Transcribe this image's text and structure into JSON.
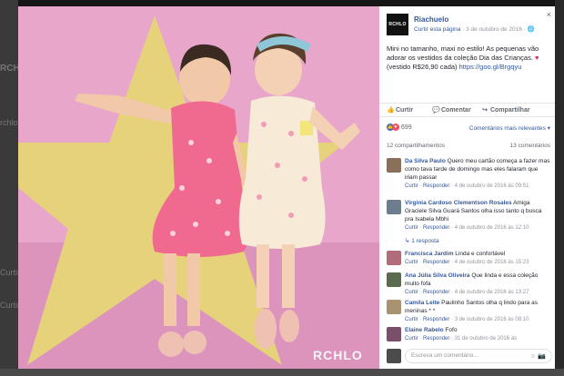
{
  "background": {
    "left_text_1": "RCHLO",
    "left_text_2": "rchlo",
    "left_text_3": "Curtir",
    "left_text_4": "Curtir"
  },
  "photo": {
    "watermark": "RCHLO"
  },
  "panel": {
    "close_icon": "×",
    "page": {
      "logo_text": "RCHLO",
      "name": "Riachuelo",
      "meta_like": "Curtir esta página",
      "meta_date": " · 3 de outubro de 2016 · ",
      "globe_icon": "🌐"
    },
    "post": {
      "text": "Mini no tamanho, maxi no estilo! As pequenas vão adorar os vestidos da coleção Dia das Crianças.",
      "heart": "♥",
      "price": "(vestido R$26,90 cada) ",
      "url": "https://goo.gl/Brgqyu"
    },
    "actions": {
      "like": "Curtir",
      "comment": "Comentar",
      "share": "Compartilhar",
      "like_icon": "👍",
      "comment_icon": "💬",
      "share_icon": "↪"
    },
    "reactions": {
      "count": "699",
      "sort_label": "Comentários mais relevantes ▾"
    },
    "stats": {
      "shares": "12 compartilhamentos",
      "comments": "13 comentários"
    },
    "comments": [
      {
        "author": "Da Silva Paulo",
        "text": " Quero meu cartão começa a fazer mas como tava tarde de domingo mas eles falaram que iriam passar",
        "like": "Curtir",
        "reply": "Responder",
        "date": " · 4 de outubro de 2016 às 09:51",
        "avatar_color": "#8a6f5a"
      },
      {
        "author": "Virginia Cardoso Clementson Rosales",
        "text": " Amiga Graciele Silva Guará Santos olha isso tanto q busca pra Isabela Mbhi",
        "like": "Curtir",
        "reply": "Responder",
        "date": " · 4 de outubro de 2016 às 12:10",
        "avatar_color": "#6b7d8e",
        "replies": "↳ 1 resposta"
      },
      {
        "author": "Francisca Jardim",
        "text": " Linda e confortável",
        "like": "Curtir",
        "reply": "Responder",
        "date": " · 4 de outubro de 2016 às 15:23",
        "avatar_color": "#b06c7a"
      },
      {
        "author": "Ana Júlia Silva Oliveira",
        "text": " Que linda e essa coleção muito fofa",
        "like": "Curtir",
        "reply": "Responder",
        "date": " · 4 de outubro de 2016 às 13:27",
        "avatar_color": "#5c6b4f"
      },
      {
        "author": "Camila Leite",
        "text": " Paulinho Santos olha q lindo para as meninas * *",
        "like": "Curtir",
        "reply": "Responder",
        "date": " · 3 de outubro de 2016 às 08:10",
        "avatar_color": "#a89270"
      },
      {
        "author": "Elaine Rabelo",
        "text": " Fofo",
        "like": "Curtir",
        "reply": "Responder",
        "date": " · 31 de outubro de 2016 às",
        "avatar_color": "#7a4f6a"
      }
    ],
    "compose": {
      "placeholder": "Escreva um comentário...",
      "icons": "☺ 📷",
      "avatar_color": "#4b4b4b"
    }
  }
}
